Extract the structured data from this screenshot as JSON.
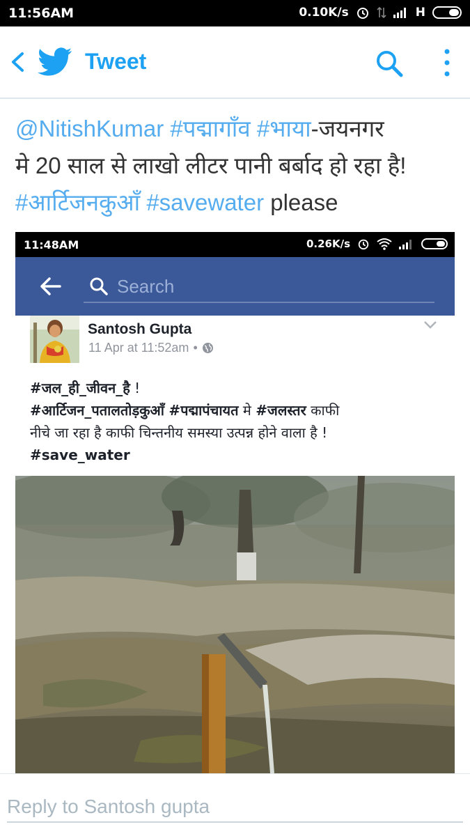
{
  "status_bar": {
    "time": "11:56AM",
    "speed": "0.10K/s",
    "network": "H"
  },
  "header": {
    "title": "Tweet"
  },
  "tweet": {
    "mention": "@NitishKumar",
    "tag1": "#पद्मागाँव",
    "tag2": "#भाया",
    "text1": "-जयनगर",
    "line2": "मे 20 साल से लाखो लीटर पानी बर्बाद हो रहा है!",
    "tag3": "#आर्टिजनकुआँ",
    "tag4": "#savewater",
    "text2": "please"
  },
  "embed": {
    "status_bar": {
      "time": "11:48AM",
      "speed": "0.26K/s"
    },
    "search": {
      "placeholder": "Search"
    },
    "post": {
      "author": "Santosh Gupta",
      "time": "11 Apr at 11:52am",
      "separator": "•",
      "line1_tag": "#जल_ही_जीवन_है",
      "line1_rest": " !",
      "line2_tag1": "#आर्टिजन_पतालतोड़कुआँ",
      "line2_mid": " ",
      "line2_tag2": "#पद्मापंचायत",
      "line2_text": " मे ",
      "line2_tag3": "#जलस्तर",
      "line2_rest": " काफी",
      "line3": "नीचे जा रहा है काफी चिन्तनीय समस्या उत्पन्न होने वाला है !",
      "line4_tag": "#save_water"
    }
  },
  "reply": {
    "placeholder": "Reply to Santosh gupta"
  },
  "colors": {
    "twitter_blue": "#1da1f2",
    "link": "#55acee",
    "facebook_blue": "#3b5998"
  }
}
